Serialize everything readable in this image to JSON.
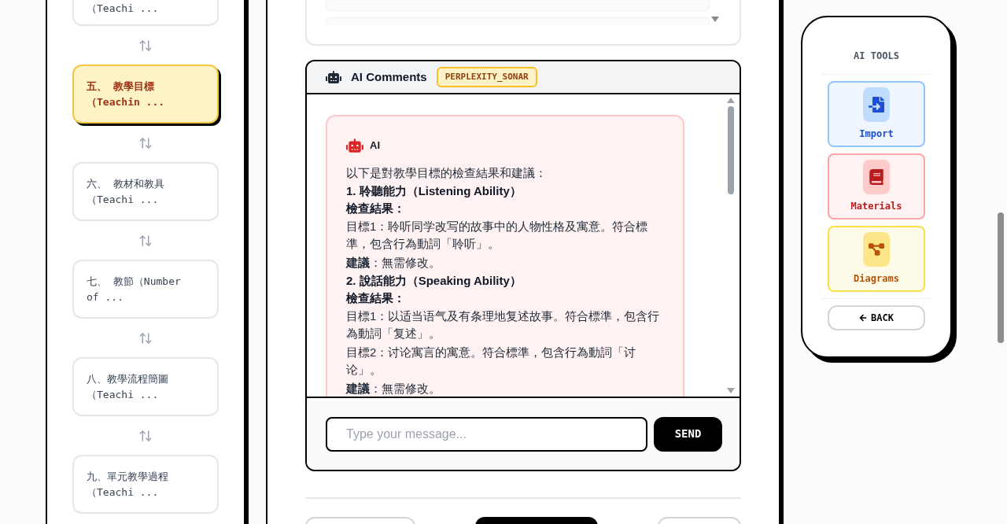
{
  "sidebar": {
    "items": [
      {
        "lines": [
          "（Teachi ..."
        ],
        "selected": false
      },
      {
        "lines": [
          "五、 教學目標",
          "（Teachin ..."
        ],
        "selected": true
      },
      {
        "lines": [
          "六、 教材和教具",
          "（Teachi ..."
        ],
        "selected": false
      },
      {
        "lines": [
          "七、 教節（Number",
          "of ..."
        ],
        "selected": false
      },
      {
        "lines": [
          "八、教學流程簡圖",
          "（Teachi ..."
        ],
        "selected": false
      },
      {
        "lines": [
          "九、單元教學過程",
          "（Teachi ..."
        ],
        "selected": false
      }
    ]
  },
  "comments": {
    "title": "AI Comments",
    "model": "PERPLEXITY_SONAR",
    "message": {
      "author": "AI",
      "lines": [
        {
          "kind": "text",
          "text": "以下是對教學目標的檢查結果和建議："
        },
        {
          "kind": "heading",
          "text": "1. 聆聽能力（Listening Ability）"
        },
        {
          "kind": "heading",
          "text": "檢查結果："
        },
        {
          "kind": "text",
          "text": "目標1：聆听同学改写的故事中的人物性格及寓意。符合標準，包含行為動詞「聆听」。"
        },
        {
          "kind": "text",
          "text": "**建議**：無需修改。"
        },
        {
          "kind": "heading",
          "text": "2. 說話能力（Speaking Ability）"
        },
        {
          "kind": "heading",
          "text": "檢查結果："
        },
        {
          "kind": "text",
          "text": "目標1：以适当语气及有条理地复述故事。符合標準，包含行為動詞「复述」。"
        },
        {
          "kind": "text",
          "text": "目標2：讨论寓言的寓意。符合標準，包含行為動詞「讨论」。"
        },
        {
          "kind": "text",
          "text": "**建議**：無需修改。"
        }
      ]
    },
    "input": {
      "placeholder": "Type your message..."
    },
    "send": "SEND"
  },
  "tools": {
    "title": "AI TOOLS",
    "items": [
      {
        "kind": "import",
        "label": "Import",
        "color": "#1d4ed8"
      },
      {
        "kind": "materials",
        "label": "Materials",
        "color": "#b91c1c"
      },
      {
        "kind": "diagrams",
        "label": "Diagrams",
        "color": "#b45309"
      }
    ],
    "back": "BACK"
  }
}
